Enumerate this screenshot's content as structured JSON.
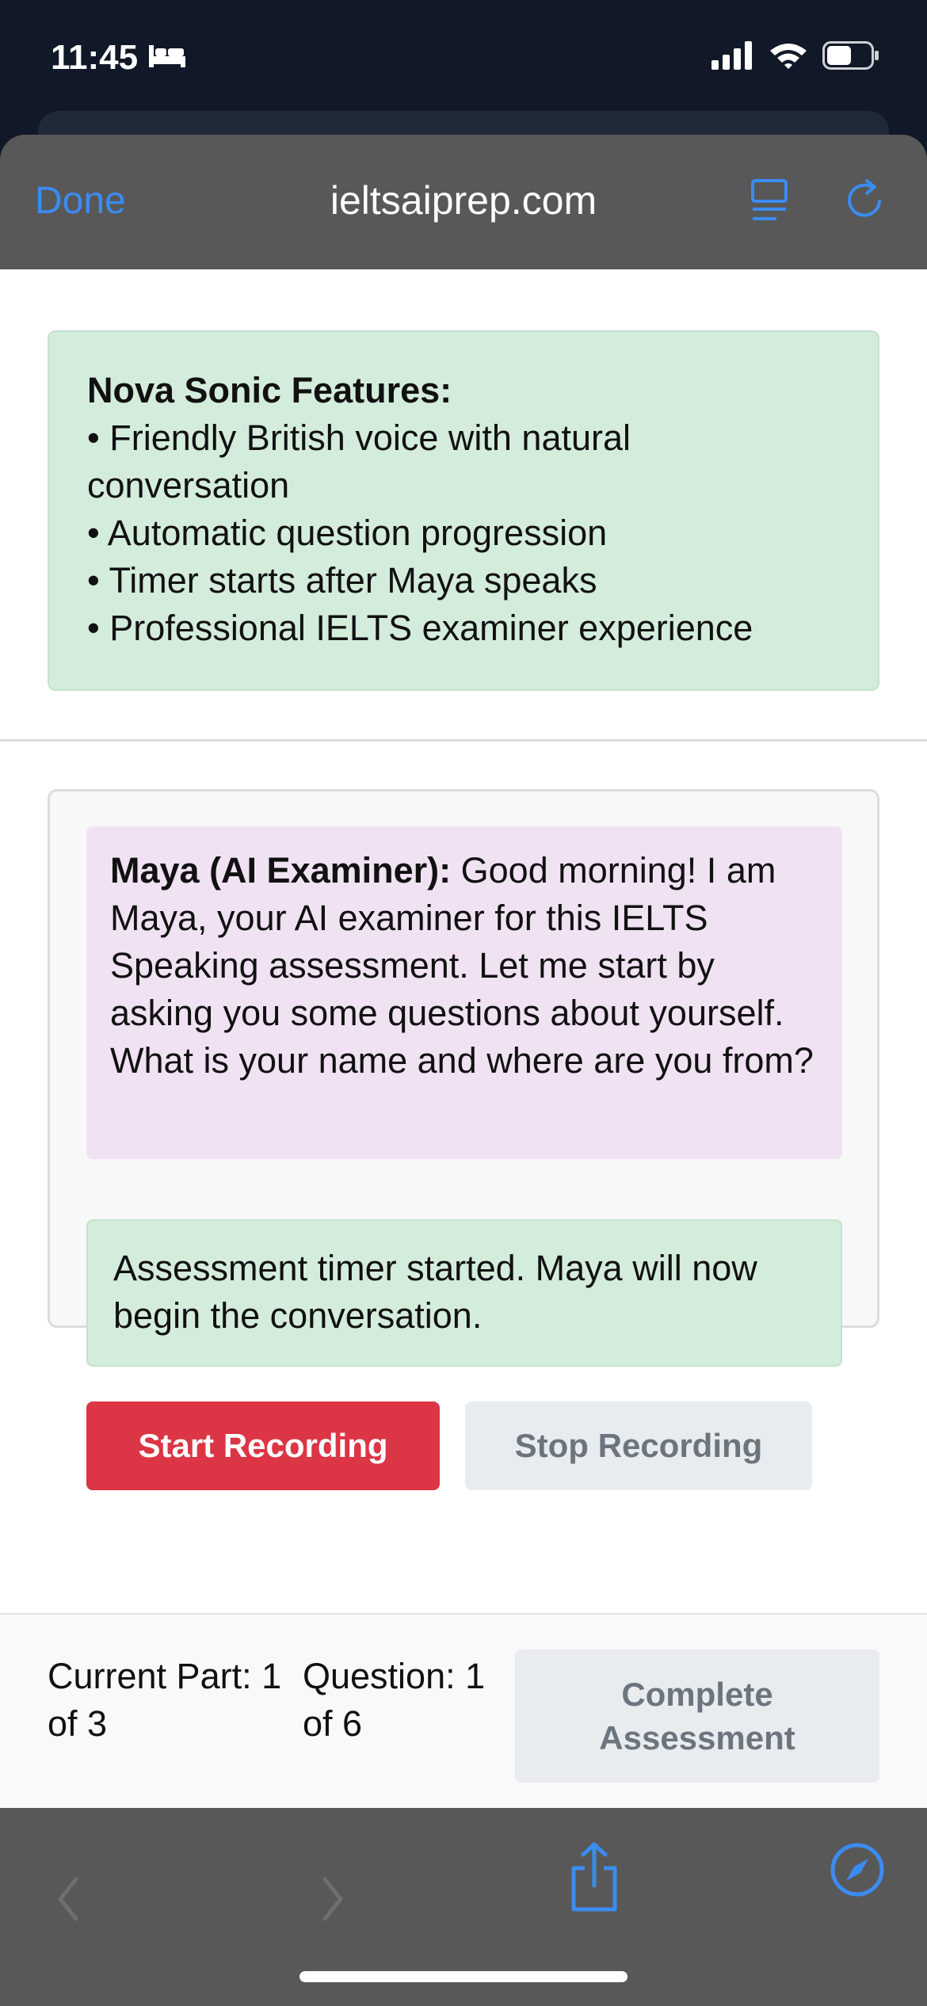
{
  "status_bar": {
    "time": "11:45",
    "sleep_icon": "bed-icon",
    "signal_icon": "cellular-signal-icon",
    "wifi_icon": "wifi-icon",
    "battery_icon": "battery-icon"
  },
  "browser": {
    "done_label": "Done",
    "url": "ieltsaiprep.com",
    "reader_icon": "reader-mode-icon",
    "reload_icon": "reload-icon",
    "accent_color": "#3b8cf2"
  },
  "features": {
    "title": "Nova Sonic Features:",
    "items": [
      "• Friendly British voice with natural conversation",
      "• Automatic question progression",
      "• Timer starts after Maya speaks",
      "• Professional IELTS examiner experience"
    ]
  },
  "conversation": {
    "speaker": "Maya (AI Examiner):",
    "message": " Good morning! I am Maya, your AI examiner for this IELTS Speaking assessment. Let me start by asking you some questions about yourself. What is your name and where are you from?",
    "status": "Assessment timer started. Maya will now begin the conversation.",
    "start_label": "Start Recording",
    "stop_label": "Stop Recording"
  },
  "progress": {
    "part_text": "Current Part: 1 of 3",
    "question_text": "Question: 1 of 6",
    "complete_label": "Complete Assessment"
  },
  "toolbar": {
    "back_icon": "chevron-left-icon",
    "forward_icon": "chevron-right-icon",
    "share_icon": "share-icon",
    "safari_icon": "compass-icon"
  }
}
